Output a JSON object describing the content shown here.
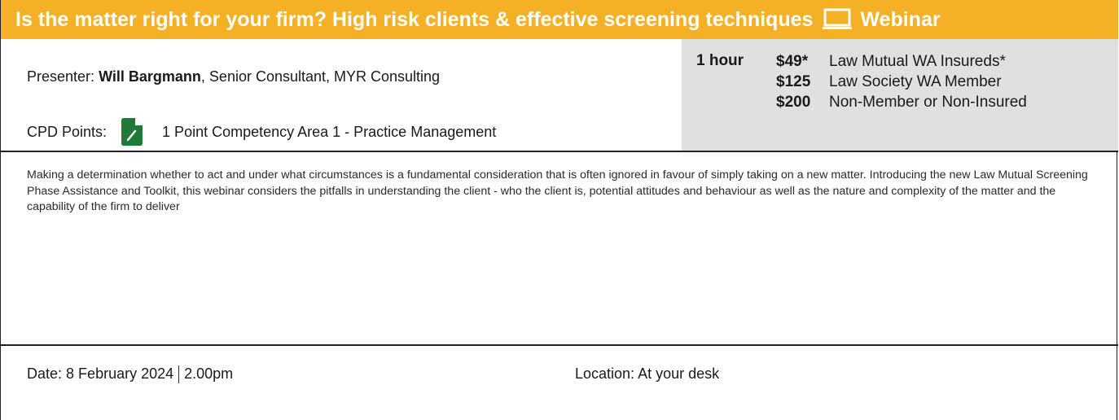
{
  "header": {
    "title": "Is the matter right for your firm?  High risk clients & effective screening techniques",
    "tag": "Webinar",
    "icon": "monitor-icon"
  },
  "presenter": {
    "label": "Presenter:",
    "name": "Will Bargmann",
    "role": ", Senior Consultant, MYR Consulting"
  },
  "cpd": {
    "label": "CPD Points:",
    "icon": "document-icon",
    "value": "1 Point Competency Area 1 - Practice Management"
  },
  "pricing": {
    "duration": "1 hour",
    "rows": [
      {
        "amount": "$49*",
        "audience": "Law Mutual WA Insureds*"
      },
      {
        "amount": "$125",
        "audience": "Law Society WA Member"
      },
      {
        "amount": "$200",
        "audience": "Non-Member or Non-Insured"
      }
    ]
  },
  "description": "Making a determination whether to act and under what circumstances is a fundamental consideration that is often ignored in favour of simply taking on a new matter. Introducing the new Law Mutual Screening Phase Assistance and Toolkit, this webinar considers the pitfalls in understanding the client - who the client is, potential attitudes and behaviour as well as the nature and complexity of the matter and the capability of the firm to deliver",
  "event": {
    "date_label": "Date:",
    "date": "8 February 2024",
    "time": "2.00pm",
    "location_label": "Location:",
    "location": "At your desk"
  },
  "colors": {
    "header_bg": "#f5b126",
    "price_bg": "#e0e0e0",
    "icon_green": "#1f7a3a"
  }
}
